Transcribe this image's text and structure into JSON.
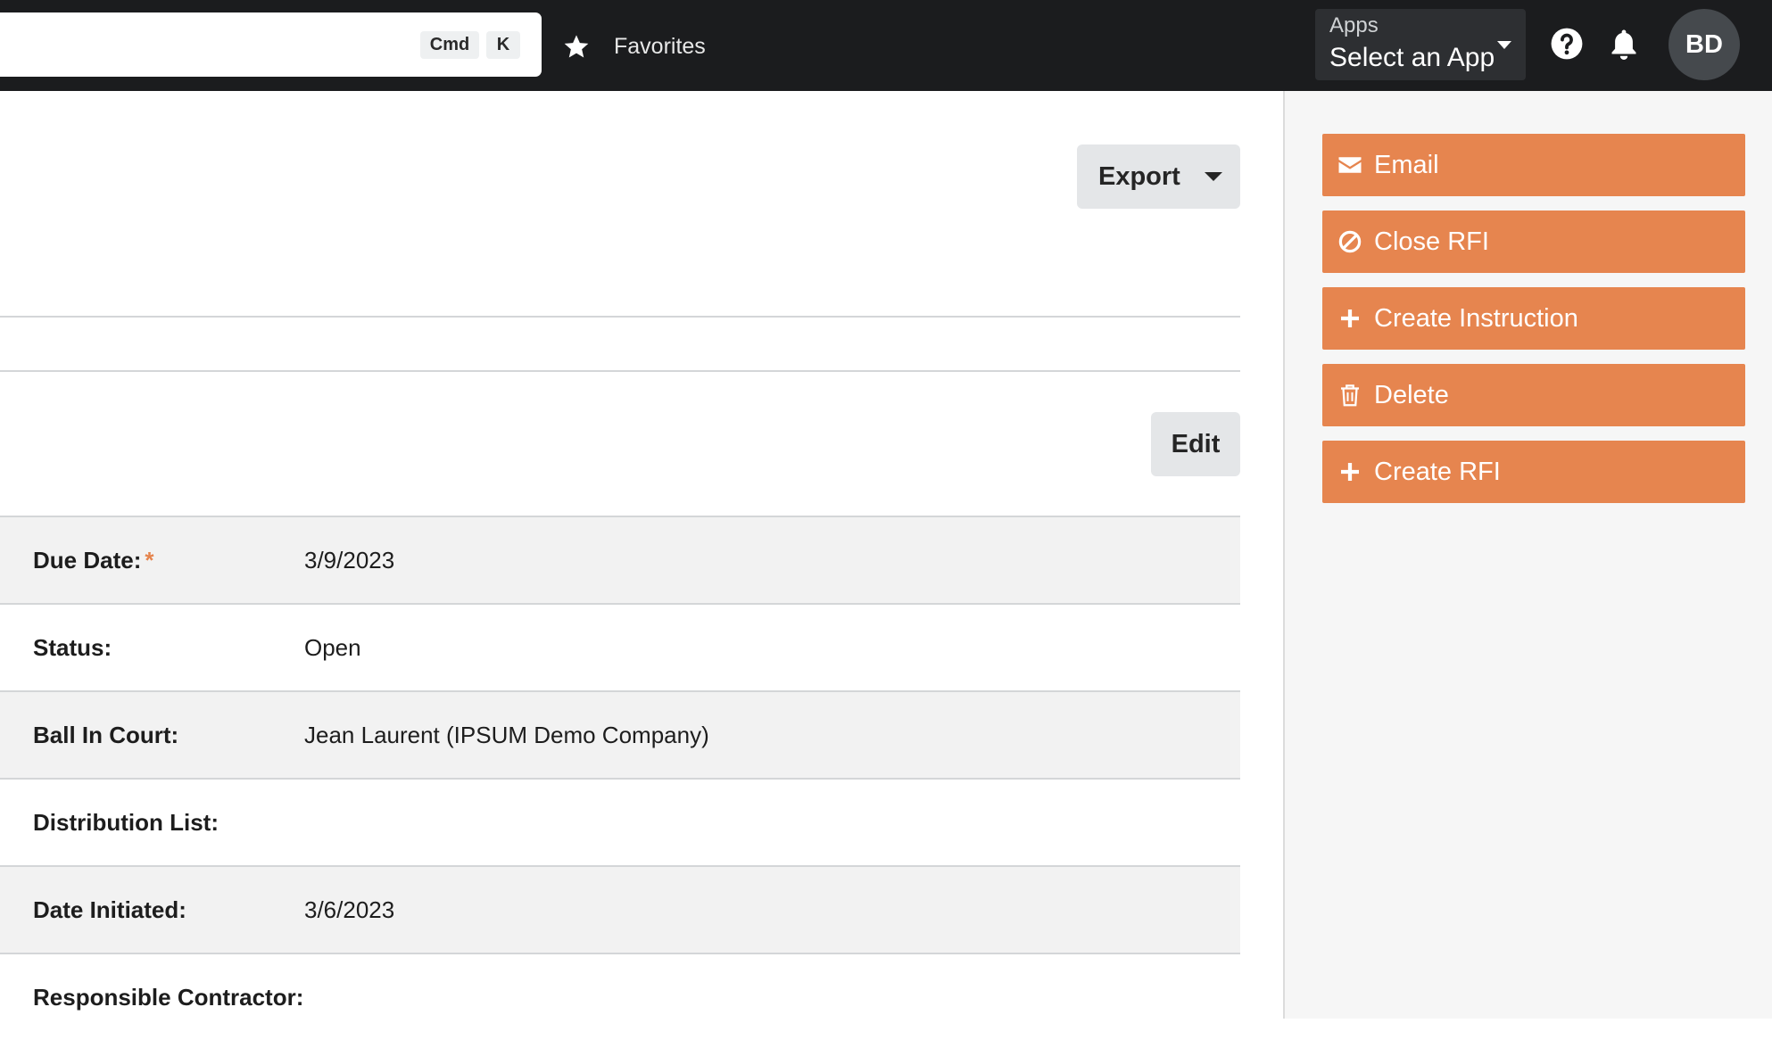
{
  "topbar": {
    "search": {
      "kbd_cmd": "Cmd",
      "kbd_k": "K"
    },
    "favorites_label": "Favorites",
    "apps": {
      "label": "Apps",
      "selected": "Select an App"
    },
    "avatar_initials": "BD"
  },
  "main": {
    "export_label": "Export",
    "edit_label": "Edit",
    "fields": [
      {
        "label": "Due Date:",
        "required_mark": "*",
        "value": "3/9/2023"
      },
      {
        "label": "Status:",
        "value": "Open"
      },
      {
        "label": "Ball In Court:",
        "value": "Jean Laurent (IPSUM Demo Company)"
      },
      {
        "label": "Distribution List:",
        "value": ""
      },
      {
        "label": "Date Initiated:",
        "value": "3/6/2023"
      },
      {
        "label": "Responsible Contractor:",
        "value": ""
      }
    ]
  },
  "sidebar": {
    "actions": [
      {
        "label": "Email",
        "icon": "envelope-icon"
      },
      {
        "label": "Close RFI",
        "icon": "ban-icon"
      },
      {
        "label": "Create Instruction",
        "icon": "plus-icon"
      },
      {
        "label": "Delete",
        "icon": "trash-icon"
      },
      {
        "label": "Create RFI",
        "icon": "plus-icon"
      }
    ]
  },
  "colors": {
    "topbar_bg": "#1b1c1e",
    "accent_orange": "#e6854f",
    "row_shade": "#f2f2f2"
  }
}
